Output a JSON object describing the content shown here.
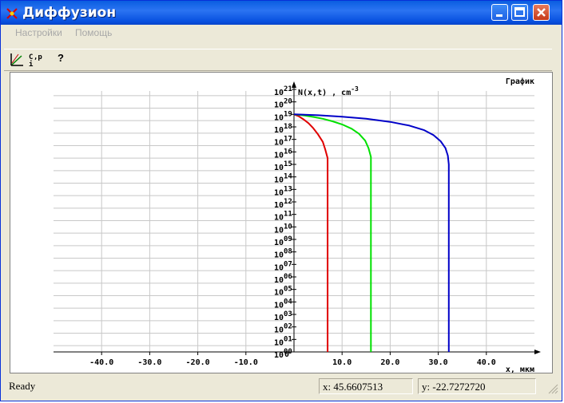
{
  "window": {
    "title": "Диффузион"
  },
  "menu": {
    "items": [
      "Настройки",
      "Помощь"
    ]
  },
  "toolbar": {
    "tools": [
      {
        "name": "axes-tool",
        "icon": "axes-icon"
      },
      {
        "name": "ci-p-tool",
        "label": "C",
        "sub": "i",
        "sup": ",p"
      },
      {
        "name": "help-tool",
        "label": "?"
      }
    ]
  },
  "status": {
    "ready": "Ready",
    "x": "x: 45.6607513",
    "y": "y: -22.7272720"
  },
  "chart_data": {
    "type": "line",
    "title": "График",
    "xlabel": "x, мкм",
    "ylabel_prefix": "N(x,t)  , cm",
    "ylabel_exp": "-3",
    "x_ticks": [
      "-40.0",
      "-30.0",
      "-20.0",
      "-10.0",
      "10.0",
      "20.0",
      "30.0",
      "40.0"
    ],
    "origin_label": "0",
    "y_tick_exponents": [
      "21",
      "20",
      "19",
      "18",
      "17",
      "16",
      "15",
      "14",
      "13",
      "12",
      "11",
      "10",
      "09",
      "08",
      "07",
      "06",
      "05",
      "04",
      "03",
      "02",
      "01",
      "00"
    ],
    "y_tick_base": "10",
    "xlim": [
      -50,
      50
    ],
    "ylim": [
      0,
      21
    ],
    "y_scale": "log10",
    "grid": true,
    "series": [
      {
        "color": "#e00000",
        "x": [
          0,
          1,
          2,
          3,
          4,
          5,
          6,
          6.5,
          7,
          7,
          7
        ],
        "y": [
          19,
          18.85,
          18.6,
          18.3,
          17.9,
          17.4,
          16.8,
          16.2,
          15.5,
          15,
          0
        ]
      },
      {
        "color": "#00e000",
        "x": [
          0,
          2,
          4,
          6,
          8,
          10,
          12,
          13.5,
          14.8,
          15.5,
          16,
          16,
          16
        ],
        "y": [
          19,
          18.92,
          18.8,
          18.65,
          18.45,
          18.2,
          17.85,
          17.45,
          16.9,
          16.3,
          15.6,
          15,
          0
        ]
      },
      {
        "color": "#0000c8",
        "x": [
          0,
          5,
          10,
          15,
          20,
          24,
          27,
          29,
          30.5,
          31.5,
          32,
          32.2,
          32.2
        ],
        "y": [
          19,
          18.93,
          18.82,
          18.65,
          18.4,
          18.1,
          17.75,
          17.35,
          16.85,
          16.3,
          15.7,
          15,
          0
        ]
      }
    ]
  }
}
